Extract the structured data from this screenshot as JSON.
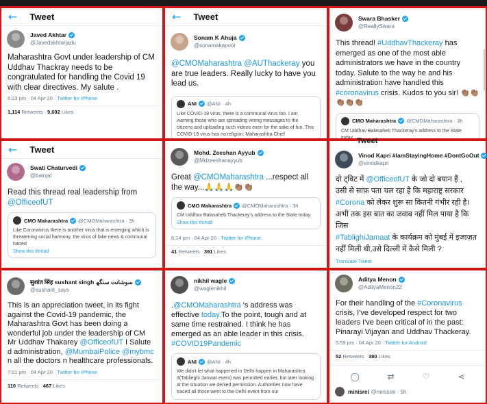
{
  "page": {
    "header_title": "Tweet"
  },
  "tweets": [
    {
      "display_name": "Javed Akhtar",
      "handle": "@Javedakhtarjadu",
      "text": "Maharashtra Govt under leadership of CM Uddhav Thackray needs to be congratulated for handling the Covid 19 with clear directives. My salute .",
      "timestamp": "6:23 pm · 04 Apr 20 ·",
      "source": "Twitter for iPhone",
      "retweets_count": "1,114",
      "retweets_label": "Retweets",
      "likes_count": "9,602",
      "likes_label": "Likes"
    },
    {
      "display_name": "Sonam K Ahuja",
      "handle": "@sonamakapoor",
      "text_mention1": "@CMOMaharashtra",
      "text_mention2": "@AUThackeray",
      "text_rest": " you are true leaders. Really lucky to have you lead us.",
      "quote": {
        "name": "ANI",
        "handle": "@ANI · 4h",
        "text": "Like COVID-19 virus, there is a communal virus too. I am warning those who are spreading wrong messages to the citizens and uploading such videos even for the sake of fun. This COVID-19 virus has no religion: Maharashtra Chief"
      }
    },
    {
      "display_name": "Swara Bhasker",
      "handle": "@ReallySwara",
      "text_a": "This thread! ",
      "hashtag1": "#UddhavThackeray",
      "text_b": " has emerged as one of the most able administrators we have in the  country today. Salute to the way he and his administration have handled this ",
      "hashtag2": "#coronavirus",
      "text_c": " crisis. Kudos to you sir! 👏🏽👏🏽👏🏽👏🏽👏🏽",
      "quote": {
        "name": "CMO Maharashtra",
        "handle": "@CMOMaharashtra · 3h",
        "text": "CM Uddhav Balasaheb Thackeray's address to the State today"
      }
    },
    {
      "display_name": "Swati Chaturvedi",
      "handle": "@bainjal",
      "text": "Read this thread real leadership from ",
      "mention": "@OfficeofUT",
      "quote": {
        "name": "CMO Maharashtra",
        "handle": "@CMOMaharashtra · 3h",
        "text": "Like Coronavirus there is another virus that is emerging which is threatening social harmony, the virus of fake news & communal hatred",
        "link": "Show this thread"
      }
    },
    {
      "display_name": "Mohd. Zeeshan Ayyub",
      "handle": "@Mdzeeshanayyub",
      "text_a": "Great ",
      "mention": "@CMOMaharashtra",
      "text_b": " ...respect all the way...🙏🙏🙏👏🏽👏🏽",
      "quote": {
        "name": "CMO Maharashtra",
        "handle": "@CMOMaharashtra · 3h",
        "text": "CM Uddhav Balasaheb Thackeray's address to the State today.",
        "link": "Show this thread"
      },
      "timestamp": "6:14 pm · 04 Apr 20 ·",
      "source": "Twitter for iPhone",
      "retweets_count": "41",
      "retweets_label": "Retweets",
      "likes_count": "391",
      "likes_label": "Likes"
    },
    {
      "top_label": "Tweet",
      "display_name": "Vinod Kapri #IamStayingHome #DontGoOut",
      "handle": "@vinodkapri",
      "line1_a": "दो ट्विट में ",
      "line1_mention": "@OfficeofUT",
      "line1_b": " के जो दो बयान हैं ,",
      "line2": "उसी से साफ़ पता चल रहा है कि महाराष्ट्र सरकार",
      "line3_hashtag": "#Corona",
      "line3_b": " को लेकर शुरू सा कितनी गंभीर रही है।",
      "line4": "अभी तक इस बात का जवाब नहीं मिल पाया है कि जिस",
      "line5_hashtag": "#TablighiJamaat",
      "line5_b": " के कार्यक्रम को मुंबई में इजाज़त",
      "line6": "नहीं मिली थी,उसे दिल्ली में कैसे मिली ?",
      "translate": "Translate Tweet"
    },
    {
      "display_name": "सुशांत सिंह sushant singh سوشانت سنگھ",
      "handle": "@sushant_says",
      "text_a": "This is an appreciation tweet, in its fight against the Covid-19 pandemic, the Maharashtra Govt has been doing a wonderful job under the leadership of CM Mr Uddhav Thakarey ",
      "mention1": "@OfficeofUT",
      "text_b": " I Salute d administration, ",
      "mention2": "@MumbaiPolice",
      "text_c": " ",
      "mention3": "@mybmc",
      "text_d": " n all the doctors n healthcare professionals.",
      "timestamp": "7:01 pm · 04 Apr 20 ·",
      "source": "Twitter for iPhone",
      "retweets_count": "110",
      "retweets_label": "Retweets",
      "likes_count": "467",
      "likes_label": "Likes"
    },
    {
      "display_name": "nikhil wagle",
      "handle": "@waglenikhil",
      "text_a": ".",
      "mention": "@CMOMaharashtra",
      "text_b": " 's address was effective ",
      "link_word": "today.",
      "text_c": "To the point, tough and at same time restrained. I think he has emerged as an able leader in this crisis. ",
      "hashtag": "#COVID19Pandemic",
      "quote": {
        "name": "ANI",
        "handle": "@ANI · 4h",
        "text": "We didn't let what happened in Delhi happen in Maharashtra. It(Tablieghi Jamaat event) was permitted earlier, but later looking at the situation we denied permission. Authorities now have traced all those went to the Delhi event from our"
      }
    },
    {
      "display_name": "Aditya Menon",
      "handle": "@AdityaMenon22",
      "text_a": "For their handling of the ",
      "hashtag": "#Coronavirus",
      "text_b": " crisis, I've developed respect for two leaders I've been critical of in the past: Pinarayi Vijayan and Uddhav Thackeray.",
      "timestamp": "5:59 pm · 04 Apr 20 ·",
      "source": "Twitter for Android",
      "retweets_count": "52",
      "retweets_label": "Retweets",
      "likes_count": "380",
      "likes_label": "Likes",
      "reply_name": "minisrei",
      "reply_handle": "@minisrei · 5h"
    }
  ],
  "icons": [
    "back-arrow-icon",
    "verified-badge-icon",
    "reply-icon",
    "retweet-icon",
    "like-icon",
    "share-icon"
  ],
  "colors": {
    "border": "#d01515",
    "link": "#1b95e0",
    "verified": "#1da1f2",
    "muted": "#657786"
  }
}
